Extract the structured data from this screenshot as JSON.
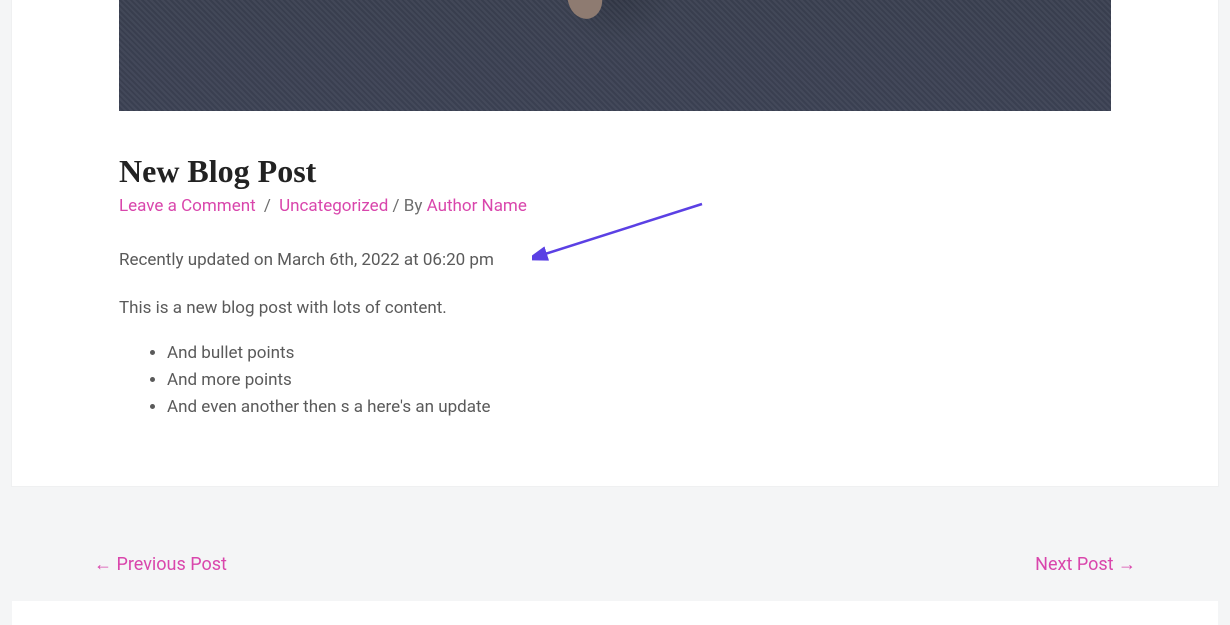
{
  "post": {
    "title": "New Blog Post",
    "updated": "Recently updated on March 6th, 2022 at 06:20 pm",
    "intro": "This is a new blog post with lots of content.",
    "bullets": [
      "And bullet points",
      "And more points",
      "And even another then s a here's an update"
    ]
  },
  "meta": {
    "comment_link": "Leave a Comment",
    "sep1": "/",
    "category": "Uncategorized",
    "by_label": "/ By",
    "author": "Author Name"
  },
  "nav": {
    "prev_arrow": "←",
    "prev_label": "Previous Post",
    "next_label": "Next Post",
    "next_arrow": "→"
  }
}
